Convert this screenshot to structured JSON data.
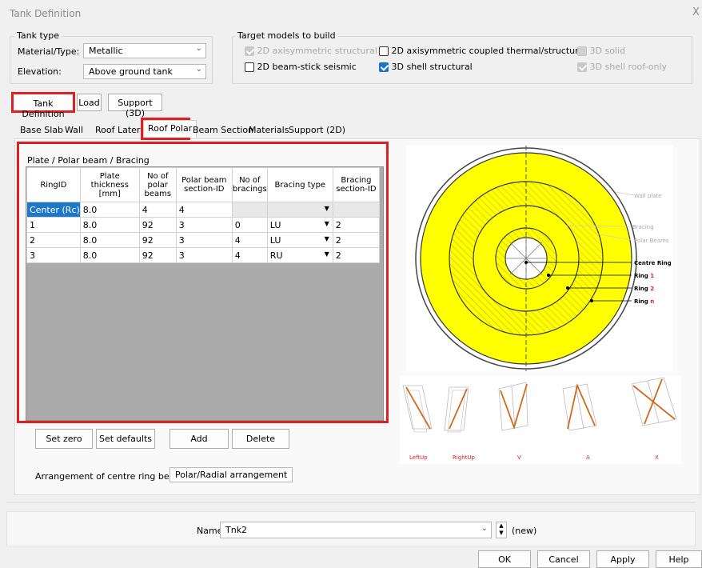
{
  "window": {
    "title": "Tank Definition",
    "close": "X"
  },
  "tank_type": {
    "group_label": "Tank type",
    "material_label": "Material/Type:",
    "material_value": "Metallic",
    "elevation_label": "Elevation:",
    "elevation_value": "Above ground tank"
  },
  "target_models": {
    "group_label": "Target models to build",
    "options": [
      {
        "label": "2D axisymmetric structural",
        "state": "disabled-checked"
      },
      {
        "label": "2D axisymmetric coupled thermal/structural",
        "state": "unchecked"
      },
      {
        "label": "3D solid",
        "state": "disabled"
      },
      {
        "label": "2D beam-stick seismic",
        "state": "unchecked"
      },
      {
        "label": "3D shell structural",
        "state": "checked"
      },
      {
        "label": "3D shell roof-only",
        "state": "disabled-checked"
      }
    ]
  },
  "main_buttons": {
    "tank_definition": "Tank Definition",
    "load": "Load",
    "support": "Support (3D)"
  },
  "tabs": [
    {
      "label": "Base Slab"
    },
    {
      "label": "Wall"
    },
    {
      "label": "Roof Lateral"
    },
    {
      "label": "Roof Polar",
      "active": true
    },
    {
      "label": "Beam Section"
    },
    {
      "label": "Materials"
    },
    {
      "label": "Support (2D)"
    }
  ],
  "grid": {
    "group_label": "Plate / Polar beam / Bracing",
    "columns": [
      "RingID",
      "Plate thickness [mm]",
      "No of polar beams",
      "Polar beam section-ID",
      "No of bracings",
      "Bracing type",
      "Bracing section-ID"
    ],
    "rows": [
      [
        "Center (Rc)",
        "8.0",
        "4",
        "4",
        "",
        "",
        ""
      ],
      [
        "1",
        "8.0",
        "92",
        "3",
        "0",
        "LU",
        "2"
      ],
      [
        "2",
        "8.0",
        "92",
        "3",
        "4",
        "LU",
        "2"
      ],
      [
        "3",
        "8.0",
        "92",
        "3",
        "4",
        "RU",
        "2"
      ]
    ]
  },
  "grid_buttons": {
    "set_zero": "Set zero",
    "set_defaults": "Set defaults",
    "add": "Add",
    "delete": "Delete"
  },
  "arrangement": {
    "label": "Arrangement of centre ring beams",
    "value": "Polar/Radial arrangement"
  },
  "diagram": {
    "wall_plate": "Wall plate",
    "bracing": "Bracing",
    "polar_beams": "Polar Beams",
    "centre_ring": "Centre Ring",
    "ring1_prefix": "Ring ",
    "ring1_suffix": "1",
    "ring2_prefix": "Ring ",
    "ring2_suffix": "2",
    "ringn_prefix": "Ring ",
    "ringn_suffix": "n",
    "ring_fill_color": "#ffff00",
    "bracing_labels": [
      "LeftUp",
      "RightUp",
      "V",
      "A",
      "X"
    ]
  },
  "footer": {
    "name_label": "Name",
    "name_value": "Tnk2",
    "new_label": "(new)",
    "ok": "OK",
    "cancel": "Cancel",
    "apply": "Apply",
    "help": "Help"
  }
}
